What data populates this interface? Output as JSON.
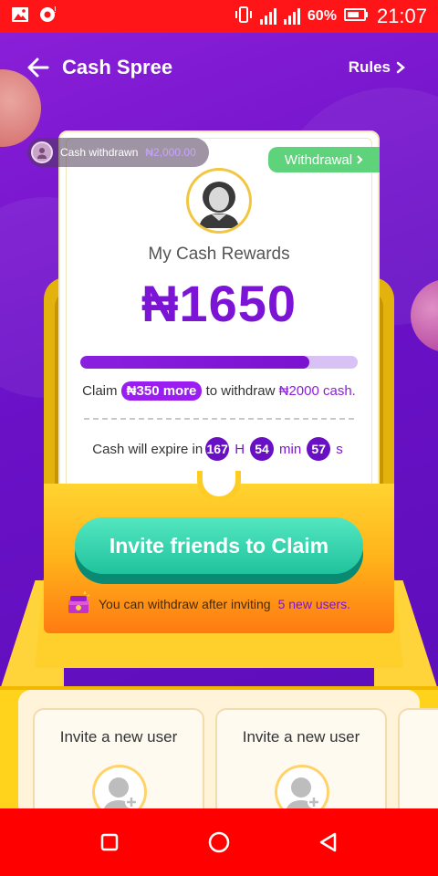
{
  "status_bar": {
    "battery": "60%",
    "time": "21:07"
  },
  "header": {
    "title": "Cash Spree",
    "rules_label": "Rules"
  },
  "withdrawn_pill": {
    "label": "Cash withdrawn",
    "amount": "₦2,000.00"
  },
  "withdrawal_button": {
    "label": "Withdrawal"
  },
  "rewards": {
    "label": "My Cash Rewards",
    "amount": "₦1650",
    "progress": 0.825
  },
  "claim": {
    "prefix": "Claim",
    "pill": "₦350 more",
    "middle": "to withdraw",
    "target": "₦2000 cash."
  },
  "expire": {
    "prefix": "Cash will expire in",
    "hours": "167",
    "hours_unit": "H",
    "minutes": "54",
    "minutes_unit": "min",
    "seconds": "57",
    "seconds_unit": "s"
  },
  "invite_button": {
    "label": "Invite friends to Claim"
  },
  "hint": {
    "text": "You can withdraw after inviting",
    "highlight": "5 new users."
  },
  "tiles": [
    {
      "label": "Invite a new user"
    },
    {
      "label": "Invite a new user"
    }
  ],
  "colors": {
    "purple": "#7b14d4",
    "green": "#20c29e",
    "gold": "#ffd21c",
    "system_red": "#ff0000"
  }
}
